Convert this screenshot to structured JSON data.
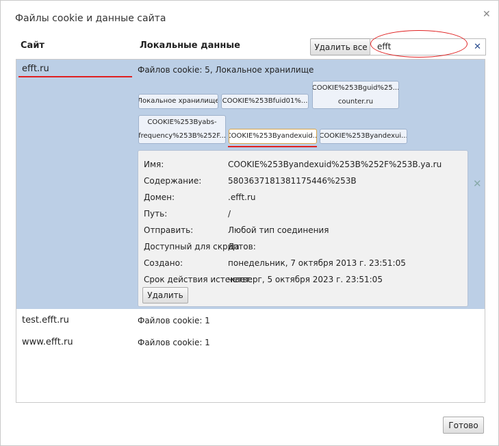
{
  "dialog": {
    "title": "Файлы cookie и данные сайта",
    "close_icon": "close-icon",
    "done_label": "Готово"
  },
  "headers": {
    "site": "Сайт",
    "local_data": "Локальные данные"
  },
  "toolbar": {
    "remove_all_label": "Удалить все"
  },
  "search": {
    "value": "efft",
    "clear_icon": "clear-icon",
    "clear_glyph": "✕"
  },
  "rows": [
    {
      "site": "efft.ru",
      "summary": "Файлов cookie: 5, Локальное хранилище",
      "selected": true
    },
    {
      "site": "test.efft.ru",
      "summary": "Файлов cookie: 1",
      "selected": false
    },
    {
      "site": "www.efft.ru",
      "summary": "Файлов cookie: 1",
      "selected": false
    }
  ],
  "chips": [
    {
      "line1": "Локальное хранилище",
      "line2": ""
    },
    {
      "line1": "COOKIE%253Bfuid01%...",
      "line2": ""
    },
    {
      "line1": "COOKIE%253Bguid%25...",
      "line2": "counter.ru"
    },
    {
      "line1": "COOKIE%253Byabs-",
      "line2": "frequency%253B%252F..."
    },
    {
      "line1": "COOKIE%253Byandexuid...",
      "line2": "",
      "active": true
    },
    {
      "line1": "COOKIE%253Byandexui...",
      "line2": ""
    }
  ],
  "details": {
    "fields": [
      {
        "label": "Имя:",
        "value": "COOKIE%253Byandexuid%253B%252F%253B.ya.ru"
      },
      {
        "label": "Содержание:",
        "value": "5803637181381175446%253B"
      },
      {
        "label": "Домен:",
        "value": ".efft.ru"
      },
      {
        "label": "Путь:",
        "value": "/"
      },
      {
        "label": "Отправить:",
        "value": "Любой тип соединения"
      },
      {
        "label": "Доступный для скриптов:",
        "value": "Да"
      },
      {
        "label": "Создано:",
        "value": "понедельник, 7 октября 2013 г. 23:51:05"
      },
      {
        "label": "Срок действия истекает:",
        "value": "четверг, 5 октября 2023 г. 23:51:05"
      }
    ],
    "delete_label": "Удалить",
    "remove_icon": "remove-site-icon",
    "remove_glyph": "✕"
  },
  "annotation_color": "#e02020"
}
